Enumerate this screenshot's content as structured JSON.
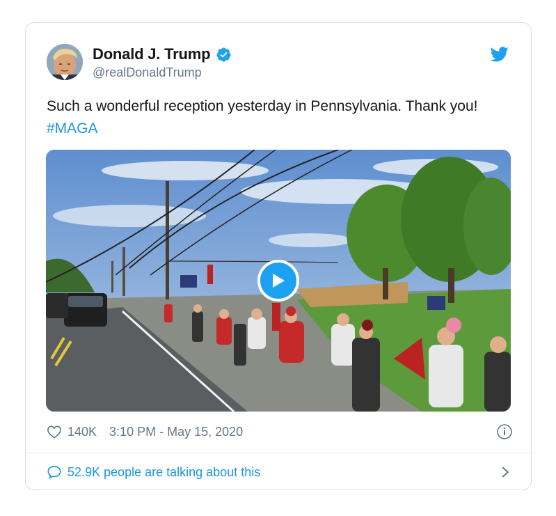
{
  "author": {
    "name": "Donald J. Trump",
    "handle": "@realDonaldTrump"
  },
  "tweet": {
    "text": "Such a wonderful reception yesterday in Pennsylvania. Thank you!",
    "hashtag": "#MAGA"
  },
  "meta": {
    "likes": "140K",
    "timestamp": "3:10 PM - May 15, 2020"
  },
  "conversation": {
    "label": "52.9K people are talking about this"
  },
  "icons": {
    "brand": "twitter-bird-icon",
    "verified": "verified-badge-icon",
    "like": "heart-icon",
    "info": "info-icon",
    "reply": "speech-bubble-icon",
    "more": "chevron-right-icon",
    "play": "play-icon"
  },
  "colors": {
    "brand_blue": "#1da1f2",
    "link_blue": "#1b95e0",
    "secondary_text": "#657786",
    "border": "#d6dde3"
  }
}
